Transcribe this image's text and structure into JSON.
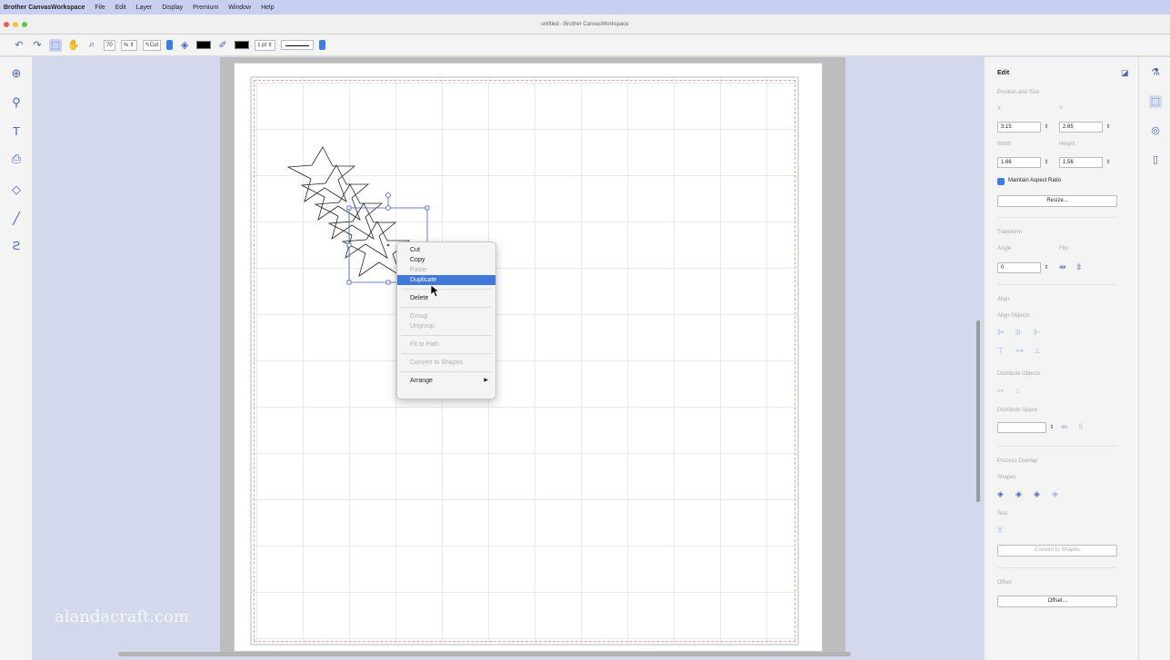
{
  "menubar": {
    "app_name": "Brother CanvasWorkspace",
    "items": [
      "File",
      "Edit",
      "Layer",
      "Display",
      "Premium",
      "Window",
      "Help"
    ]
  },
  "window": {
    "title": "untitled - Brother CanvasWorkspace"
  },
  "toolbar": {
    "zoom_value": "70",
    "zoom_unit": "%",
    "cut_mode": "Cut",
    "line_width": "1",
    "line_unit": "pt"
  },
  "canvas": {
    "watermark": "alandacraft.com"
  },
  "context_menu": {
    "cut": "Cut",
    "copy": "Copy",
    "paste": "Paste",
    "duplicate": "Duplicate",
    "delete": "Delete",
    "group": "Group",
    "ungroup": "Ungroup",
    "fit_to_path": "Fit to Path",
    "convert_to_shapes": "Convert to Shapes",
    "arrange": "Arrange"
  },
  "edit_panel": {
    "title": "Edit",
    "position_size": "Position and Size",
    "x_label": "X",
    "y_label": "Y",
    "x_value": "3.15",
    "y_value": "2.65",
    "width_label": "Width",
    "height_label": "Height",
    "width_value": "1.66",
    "height_value": "1.56",
    "maintain_aspect": "Maintain Aspect Ratio",
    "resize_button": "Resize...",
    "transform": "Transform",
    "angle_label": "Angle",
    "flip_label": "Flip",
    "angle_value": "0",
    "align": "Align",
    "align_objects": "Align Objects",
    "distribute_objects": "Distribute Objects",
    "distribute_space": "Distribute Space",
    "process_overlap": "Process Overlap",
    "shapes_label": "Shapes",
    "text_label": "Text",
    "convert_to_shapes_button": "Convert to Shapes",
    "offset_heading": "Offset",
    "offset_button": "Offset..."
  },
  "colors": {
    "accent": "#3f78d9",
    "menubar_bg": "#c9cff0",
    "canvas_bg": "#d3d8ec",
    "icon_blue": "#4a64b8"
  }
}
